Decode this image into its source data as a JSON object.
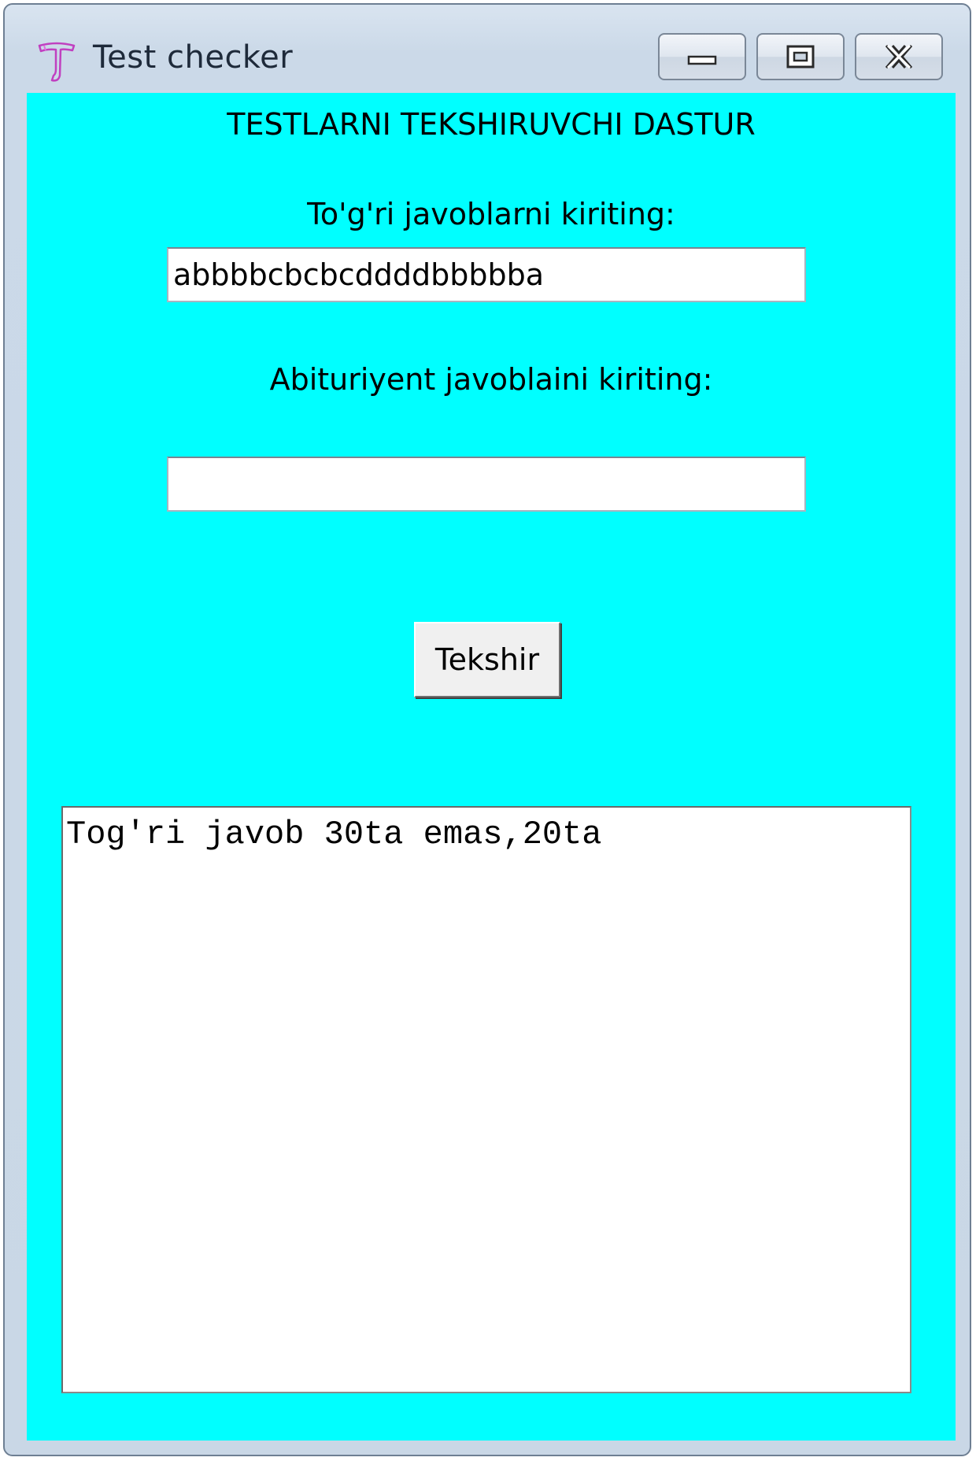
{
  "window": {
    "title": "Test checker"
  },
  "titlebar_buttons": {
    "minimize": "minimize-icon",
    "maximize": "restore-icon",
    "close": "close-icon"
  },
  "form": {
    "heading": "TESTLARNI TEKSHIRUVCHI DASTUR",
    "correct_label": "To'g'ri javoblarni kiriting:",
    "correct_value": "abbbbcbcbcddddbbbbba",
    "student_label": "Abituriyent javoblaini kiriting:",
    "student_value": "",
    "check_button": "Tekshir",
    "result_text": "Tog'ri javob 30ta emas,20ta"
  },
  "colors": {
    "client_background": "#00ffff",
    "app_icon": "#c040c0"
  }
}
